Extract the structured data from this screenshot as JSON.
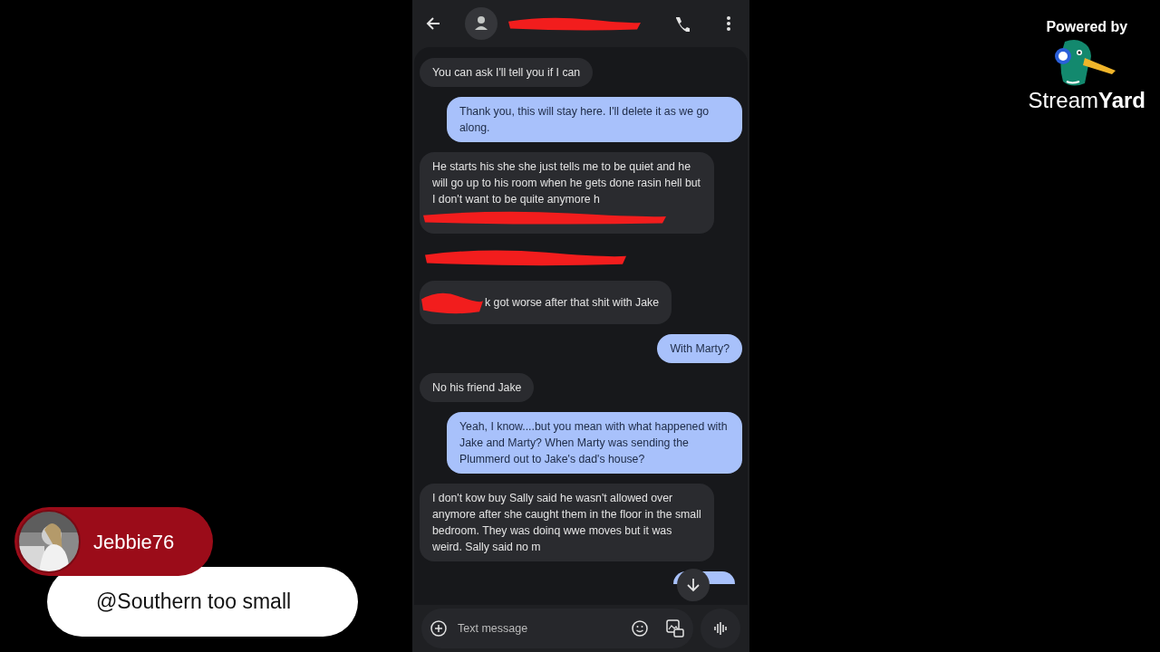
{
  "messages": [
    {
      "kind": "received",
      "text": "You can ask I'll tell you if I can"
    },
    {
      "kind": "sent",
      "text": "Thank you, this will stay here. I'll delete it as we go along."
    },
    {
      "kind": "redacted_tail",
      "text": "He starts his she she just tells me to be quiet and he will go up to his room when he gets done rasin hell but I don't want to be quite anymore h"
    },
    {
      "kind": "redacted"
    },
    {
      "kind": "redacted_head",
      "text": "k got worse after that shit with Jake"
    },
    {
      "kind": "sent",
      "text": "With Marty?"
    },
    {
      "kind": "received",
      "text": "No his friend Jake"
    },
    {
      "kind": "sent",
      "text": "Yeah, I know....but you mean with what happened with Jake and Marty? When Marty was sending the Plummerd out to Jake's dad's house?"
    },
    {
      "kind": "received",
      "text": "I don't kow buy Sally said he wasn't allowed over anymore after she caught them in the floor in the small bedroom. They was doinq wwe moves but it was weird. Sally said no m"
    }
  ],
  "compose": {
    "placeholder": "Text message"
  },
  "branding": {
    "label": "Powered by",
    "brand": "Stream**Yard**"
  },
  "comment": {
    "author": "Jebbie76",
    "text": "@Southern too small"
  }
}
